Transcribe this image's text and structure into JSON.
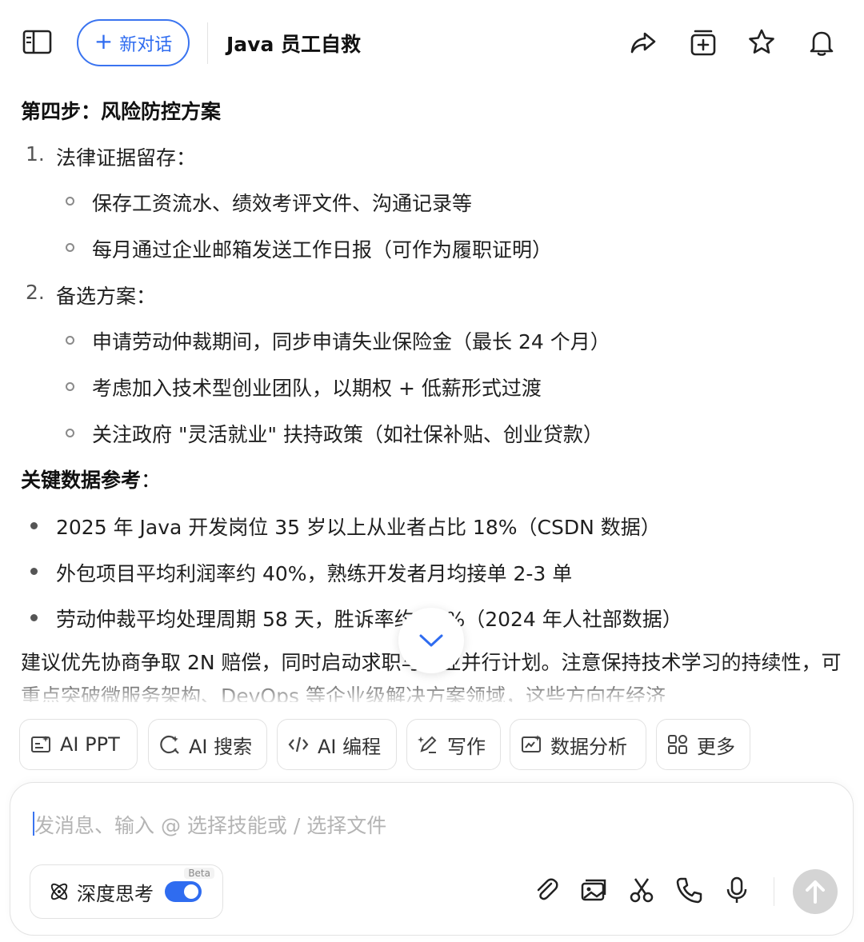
{
  "header": {
    "new_chat_label": "新对话",
    "title": "Java 员工自救",
    "icons": [
      "sidebar-toggle-icon",
      "share-icon",
      "add-to-collection-icon",
      "star-icon",
      "bell-icon"
    ]
  },
  "content": {
    "step_heading": "第四步：风险防控方案",
    "ordered": [
      {
        "num": "1.",
        "label": "法律证据留存：",
        "items": [
          "保存工资流水、绩效考评文件、沟通记录等",
          "每月通过企业邮箱发送工作日报（可作为履职证明）"
        ]
      },
      {
        "num": "2.",
        "label": "备选方案：",
        "items": [
          "申请劳动仲裁期间，同步申请失业保险金（最长 24 个月）",
          "考虑加入技术型创业团队，以期权 + 低薪形式过渡",
          "关注政府 \"灵活就业\" 扶持政策（如社保补贴、创业贷款）"
        ]
      }
    ],
    "data_heading": "关键数据参考",
    "data_heading_colon": "：",
    "bullets": [
      "2025 年 Java 开发岗位 35 岁以上从业者占比 18%（CSDN 数据）",
      "外包项目平均利润率约 40%，熟练开发者月均接单 2-3 单",
      "劳动仲裁平均处理周期 58 天，胜诉率约 63%（2024 年人社部数据）"
    ],
    "paragraph": "建议优先协商争取 2N 赔偿，同时启动求职与副业并行计划。注意保持技术学习的持续性，可重点突破微服务架构、DevOps 等企业级解决方案领域，这些方向在经济"
  },
  "chips": [
    "AI PPT",
    "AI 搜索",
    "AI 编程",
    "写作",
    "数据分析",
    "更多"
  ],
  "input": {
    "placeholder": "发消息、输入 @ 选择技能或 / 选择文件",
    "deep_think_label": "深度思考",
    "beta_label": "Beta",
    "deep_think_enabled": true,
    "tools": [
      "paperclip-icon",
      "image-icon",
      "scissors-icon",
      "phone-icon",
      "microphone-icon"
    ]
  },
  "colors": {
    "accent": "#2f6cf0",
    "send_disabled": "#d4d4d4"
  }
}
